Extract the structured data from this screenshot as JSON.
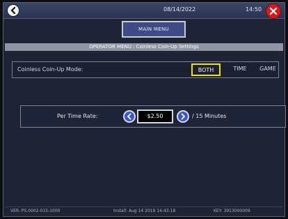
{
  "header": {
    "date": "08/14/2022",
    "time": "14:50"
  },
  "main_menu": {
    "label": "MAIN MENU"
  },
  "breadcrumb": {
    "text": "OPERATOR MENU : Coinless Coin-Up Settings"
  },
  "coinless_mode": {
    "label": "Coinless Coin-Up Mode:",
    "options": [
      "BOTH",
      "TIME",
      "GAME"
    ],
    "selected": "BOTH"
  },
  "per_time_rate": {
    "label": "Per Time Rate:",
    "value": "$2.50",
    "unit": "/ 15 Minutes"
  },
  "status_bar": {
    "left": "VER: PS.0002-015-1000",
    "middle": "Install: Aug 14 2019 14:43:18",
    "right": "KEY: 3913000009"
  },
  "colors": {
    "selection_highlight": "#f2e400",
    "close_button": "#d11d22",
    "arrow_button": "#3e57c8"
  },
  "icons": {
    "back": "back-arrow-icon",
    "close": "close-x-icon",
    "decrease": "left-arrow-icon",
    "increase": "right-arrow-icon"
  }
}
